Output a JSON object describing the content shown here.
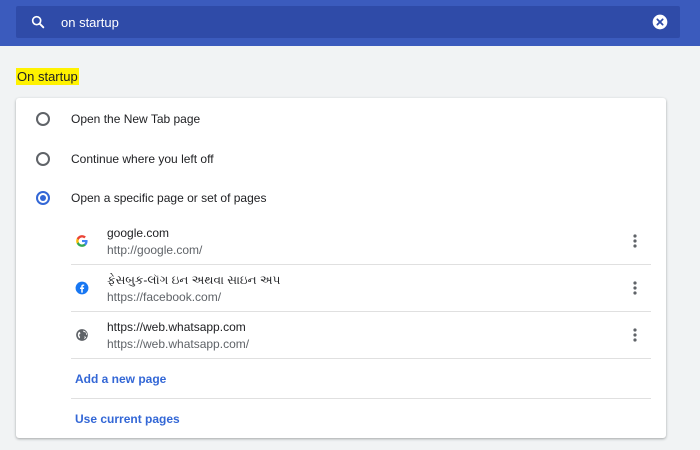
{
  "search": {
    "query": "on startup",
    "icon": "search-icon",
    "clear_icon": "clear-icon"
  },
  "section": {
    "title": "On startup",
    "highlight_color": "#fff200"
  },
  "options": [
    {
      "label": "Open the New Tab page",
      "checked": false
    },
    {
      "label": "Continue where you left off",
      "checked": false
    },
    {
      "label": "Open a specific page or set of pages",
      "checked": true
    }
  ],
  "pages": [
    {
      "title": "google.com",
      "url": "http://google.com/",
      "icon": "google-icon"
    },
    {
      "title": "ફેસબુક-લૉગ ઇન અથવા સાઇન અપ",
      "url": "https://facebook.com/",
      "icon": "facebook-icon"
    },
    {
      "title": "https://web.whatsapp.com",
      "url": "https://web.whatsapp.com/",
      "icon": "globe-icon"
    }
  ],
  "actions": {
    "add_page": "Add a new page",
    "use_current": "Use current pages"
  },
  "colors": {
    "header": "#3b5bbd",
    "accent": "#3367d6",
    "background": "#f1f3f4"
  }
}
